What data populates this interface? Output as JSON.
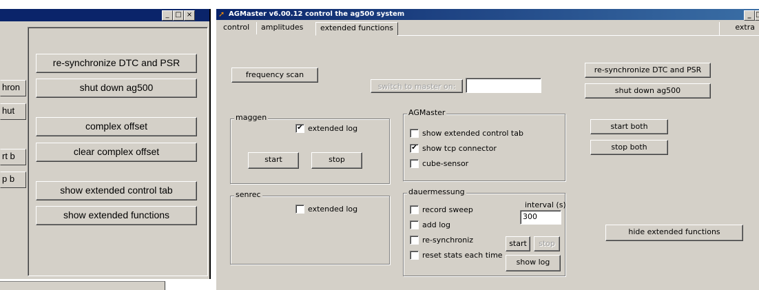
{
  "left_window": {
    "buttons": [
      "re-synchronize DTC and PSR",
      "shut down ag500",
      "complex offset",
      "clear complex offset",
      "show extended control tab",
      "show extended functions"
    ],
    "stubs": [
      "hron",
      "hut",
      "rt b",
      "p b"
    ],
    "window_controls": [
      "_",
      "□",
      "×"
    ]
  },
  "right_window": {
    "title": "AGMaster v6.00.12    control the ag500 system",
    "tabs": [
      "control",
      "amplitudes",
      "extended functions"
    ],
    "active_tab": "extended functions",
    "extra_label": "extra",
    "frequency_scan": "frequency scan",
    "switch_master": "switch to master on:",
    "master_input_value": "",
    "right_buttons": {
      "resync": "re-synchronize DTC and PSR",
      "shutdown": "shut down ag500",
      "start_both": "start both",
      "stop_both": "stop both",
      "hide_ext": "hide extended functions"
    },
    "maggen": {
      "label": "maggen",
      "extended_log": "extended log",
      "extended_log_checked": true,
      "start": "start",
      "stop": "stop"
    },
    "senrec": {
      "label": "senrec",
      "extended_log": "extended log",
      "extended_log_checked": false
    },
    "agmaster": {
      "label": "AGMaster",
      "options": [
        {
          "label": "show extended control tab",
          "checked": false
        },
        {
          "label": "show tcp connector",
          "checked": true
        },
        {
          "label": "cube-sensor",
          "checked": false
        }
      ]
    },
    "dauermessung": {
      "label": "dauermessung",
      "options": [
        {
          "label": "record sweep",
          "checked": false
        },
        {
          "label": "add log",
          "checked": false
        },
        {
          "label": "re-synchroniz",
          "checked": false
        },
        {
          "label": "reset stats each time",
          "checked": false
        }
      ],
      "interval_label": "interval (s)",
      "interval_value": "300",
      "start": "start",
      "stop": "stop",
      "show_log": "show log"
    }
  }
}
